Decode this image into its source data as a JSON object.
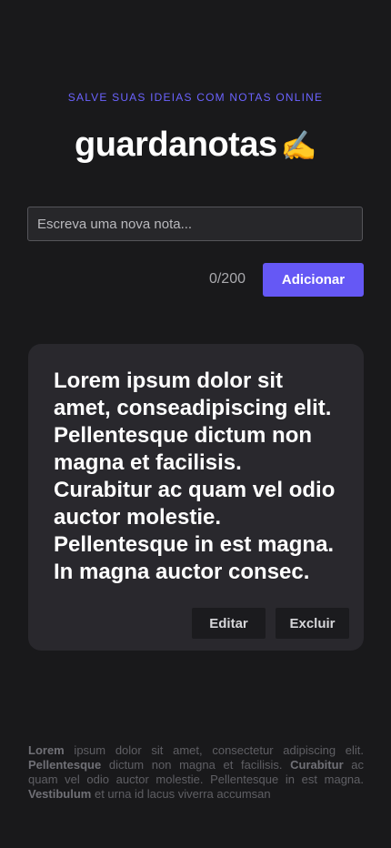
{
  "header": {
    "tagline": "SALVE SUAS IDEIAS COM NOTAS ONLINE",
    "brand_name": "guardanotas",
    "brand_emoji": "✍️"
  },
  "composer": {
    "placeholder": "Escreva uma nova nota...",
    "value": "",
    "counter": "0/200",
    "add_label": "Adicionar"
  },
  "notes": [
    {
      "text": "Lorem ipsum dolor sit amet, conseadipiscing elit. Pellentesque dictum non magna et facilisis. Curabitur ac quam vel odio auctor molestie. Pellentesque in est magna. In magna auctor consec.",
      "edit_label": "Editar",
      "delete_label": "Excluir"
    }
  ],
  "footer": {
    "segments": [
      {
        "text": "Lorem",
        "bold": true
      },
      {
        "text": " ipsum dolor sit amet, consectetur adipiscing elit. ",
        "bold": false
      },
      {
        "text": "Pellentesque",
        "bold": true
      },
      {
        "text": " dictum non magna et facilisis. ",
        "bold": false
      },
      {
        "text": "Curabitur",
        "bold": true
      },
      {
        "text": " ac quam vel odio auctor molestie. Pellentesque in est magna. ",
        "bold": false
      },
      {
        "text": "Vestibulum",
        "bold": true
      },
      {
        "text": " et urna id lacus viverra accumsan",
        "bold": false
      }
    ]
  },
  "colors": {
    "background": "#19191b",
    "accent": "#6558f5",
    "card": "#29282d"
  }
}
